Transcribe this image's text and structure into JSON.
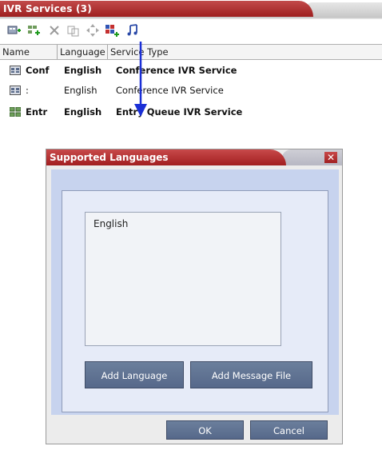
{
  "panel": {
    "title": "IVR Services (3)"
  },
  "toolbar": {
    "icons": [
      "new-service-icon",
      "new-queue-service-icon",
      "delete-icon",
      "copy-icon",
      "move-icon",
      "supported-languages-icon",
      "music-icon"
    ]
  },
  "table": {
    "columns": [
      "Name",
      "Language",
      "Service Type"
    ],
    "rows": [
      {
        "name": "Conf",
        "language": "English",
        "type": "Conference IVR Service",
        "bold": true
      },
      {
        "name": ":",
        "language": "English",
        "type": "Conference IVR Service",
        "bold": false
      },
      {
        "name": "Entr",
        "language": "English",
        "type": "Entry Queue IVR Service",
        "bold": true
      }
    ]
  },
  "dialog": {
    "title": "Supported Languages",
    "close": "✕",
    "languages": [
      "English"
    ],
    "add_language": "Add Language",
    "add_message_file": "Add Message File",
    "ok": "OK",
    "cancel": "Cancel"
  },
  "colors": {
    "title_red": "#a82222",
    "button_blue": "#5f7293",
    "arrow_blue": "#1a2fd6"
  }
}
